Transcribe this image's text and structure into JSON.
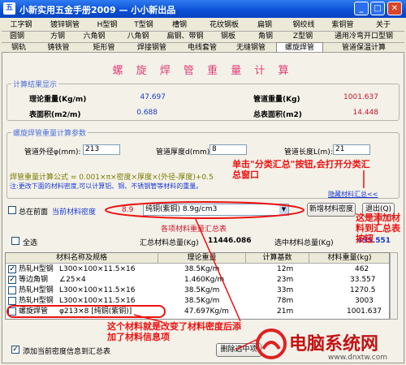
{
  "window": {
    "title": "小新实用五金手册2009 — 小小新出品",
    "icon": "app-icon"
  },
  "tabs_row1": [
    "工字钢",
    "镀锌钢管",
    "H型钢",
    "T型钢",
    "槽钢",
    "花纹钢板",
    "扁钢",
    "钢绞线",
    "紫铜管",
    "关于"
  ],
  "tabs_row2": [
    "圆钢",
    "方钢",
    "六角钢",
    "八角钢",
    "扁钢、带钢",
    "钢板",
    "角钢",
    "Z型钢",
    "通用冷弯开口型钢"
  ],
  "tabs_row3": [
    "钢轨",
    "铸铁管",
    "矩形管",
    "焊接钢管",
    "电线套管",
    "无缝钢管",
    "螺旋焊管",
    "管道保温计算"
  ],
  "active_tab": "螺旋焊管",
  "heading": "螺 旋 焊 管 重 量 计 算",
  "results": {
    "group_label": "计算结果显示",
    "theory_label": "理论重量(Kg/m)",
    "theory_value": "47.697",
    "pipe_weight_label": "管道重量(Kg)",
    "pipe_weight_value": "1001.637",
    "surface_label": "表面积(m2/m)",
    "surface_value": "0.688",
    "total_surface_label": "总表面积(m2)",
    "total_surface_value": "14.448"
  },
  "params": {
    "group_label": "螺旋焊管重量计算参数",
    "od_label": "管道外径φ(mm):",
    "od_value": "213",
    "thick_label": "管道厚度d(mm)",
    "thick_value": "8",
    "length_label": "管道长度L(m):",
    "length_value": "21",
    "formula": "焊管重量计算公式 = 0.001×π×密度×厚度×(外径-厚度)+0.5",
    "note": "注:更改下面的材料密度,可以计算铝、铜、不锈钢管等材料的重量。",
    "hide_button": "隐藏材料汇总<<"
  },
  "material": {
    "topmost_label": "总在前面",
    "current_density_label": "当前材料密度",
    "density_value": "8.9",
    "density_select": "纯铜(紫铜) 8.9g/cm3",
    "add_button": "新增材料密度",
    "exit_button": "退出(Q)"
  },
  "summary": {
    "title": "各项材料重量汇总表",
    "select_all": "全选",
    "total_label": "汇总材料总量(Kg)",
    "total_value": "11446.086",
    "selected_label": "选中材料总量(Kg)",
    "selected_value": "495.551",
    "columns": [
      "材料名称及规格",
      "理论重量",
      "计算基数",
      "材料重量(kg)"
    ],
    "rows": [
      {
        "checked": "✓",
        "name": "热轧H型钢",
        "spec": "L300×100×11.5×16",
        "theory": "38.5Kg/m",
        "base": "12m",
        "weight": "462"
      },
      {
        "checked": "✓",
        "name": "等边角钢",
        "spec": "∠25×4",
        "theory": "1.460Kg/m",
        "base": "23m",
        "weight": "33.557"
      },
      {
        "checked": "",
        "name": "热轧H型钢",
        "spec": "L300×100×11.5×16",
        "theory": "38.5Kg/m",
        "base": "33m",
        "weight": "1270.5"
      },
      {
        "checked": "",
        "name": "热轧H型钢",
        "spec": "L300×100×11.5×16",
        "theory": "38.5Kg/m",
        "base": "78m",
        "weight": "3003"
      },
      {
        "checked": "",
        "name": "螺旋焊管",
        "spec": "φ213×8 [纯铜(紫铜)]",
        "theory": "47.697Kg/m",
        "base": "21m",
        "weight": "1001.637"
      }
    ],
    "add_info_label": "添加当前密度信息到汇总表",
    "delete_button": "删除选中项"
  },
  "annotations": {
    "summary_tip": "单击\"分类汇总\"按钮,会打开分类汇总窗口",
    "add_tip": "这是添加材料到汇总表按钮",
    "density_tip": "这个材料就是改变了材料密度后添加了材料信息项"
  },
  "watermark": {
    "text": "电脑系统网",
    "url": "www.dnxtw.com"
  },
  "colors": {
    "title_blue": "#0a4fd4",
    "result_blue": "#1a38d6",
    "result_red": "#c8142a",
    "annotation_red": "#e11111",
    "heading_pink": "#e0407a"
  }
}
